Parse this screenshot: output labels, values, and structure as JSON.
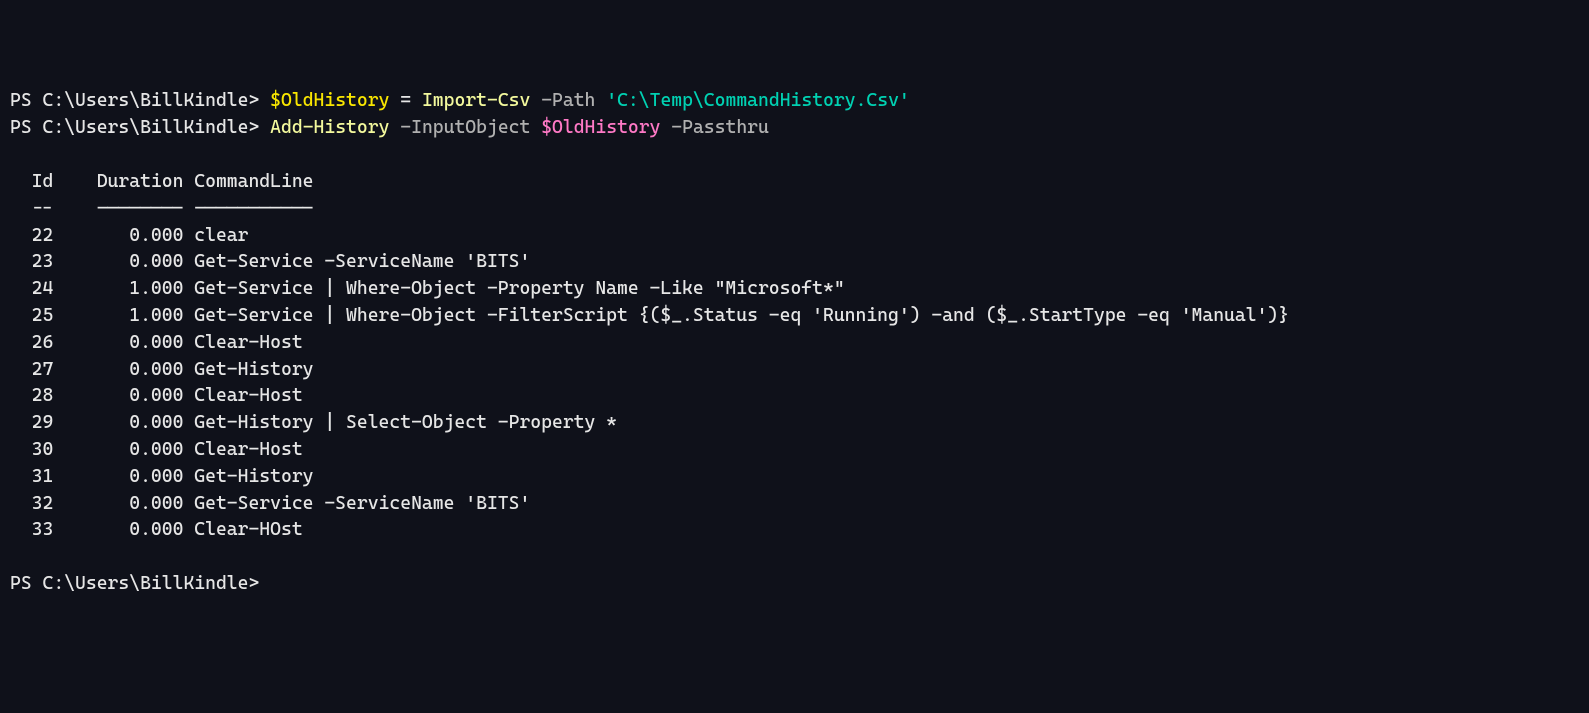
{
  "prompt_text": "PS C:\\Users\\BillKindle>",
  "cmd1": {
    "lhs": "$OldHistory",
    "eq": " = ",
    "cmdlet": "Import-Csv",
    "param_path": " -Path ",
    "path_value": "'C:\\Temp\\CommandHistory.Csv'"
  },
  "cmd2": {
    "cmdlet": "Add-History",
    "param_input": " -InputObject ",
    "input_var": "$OldHistory",
    "param_pass": " -Passthru"
  },
  "headers": {
    "id": "Id",
    "duration": "Duration",
    "commandline": "CommandLine"
  },
  "rules": {
    "id": "--",
    "duration": "--------",
    "commandline": "-----------"
  },
  "rows": [
    {
      "id": "22",
      "duration": "0.000",
      "cmd": "clear"
    },
    {
      "id": "23",
      "duration": "0.000",
      "cmd": "Get-Service -ServiceName 'BITS'"
    },
    {
      "id": "24",
      "duration": "1.000",
      "cmd": "Get-Service | Where-Object -Property Name -Like \"Microsoft*\""
    },
    {
      "id": "25",
      "duration": "1.000",
      "cmd": "Get-Service | Where-Object -FilterScript {($_.Status -eq 'Running') -and ($_.StartType -eq 'Manual')}"
    },
    {
      "id": "26",
      "duration": "0.000",
      "cmd": "Clear-Host"
    },
    {
      "id": "27",
      "duration": "0.000",
      "cmd": "Get-History"
    },
    {
      "id": "28",
      "duration": "0.000",
      "cmd": "Clear-Host"
    },
    {
      "id": "29",
      "duration": "0.000",
      "cmd": "Get-History | Select-Object -Property *"
    },
    {
      "id": "30",
      "duration": "0.000",
      "cmd": "Clear-Host"
    },
    {
      "id": "31",
      "duration": "0.000",
      "cmd": "Get-History"
    },
    {
      "id": "32",
      "duration": "0.000",
      "cmd": "Get-Service -ServiceName 'BITS'"
    },
    {
      "id": "33",
      "duration": "0.000",
      "cmd": "Clear-HOst"
    }
  ]
}
